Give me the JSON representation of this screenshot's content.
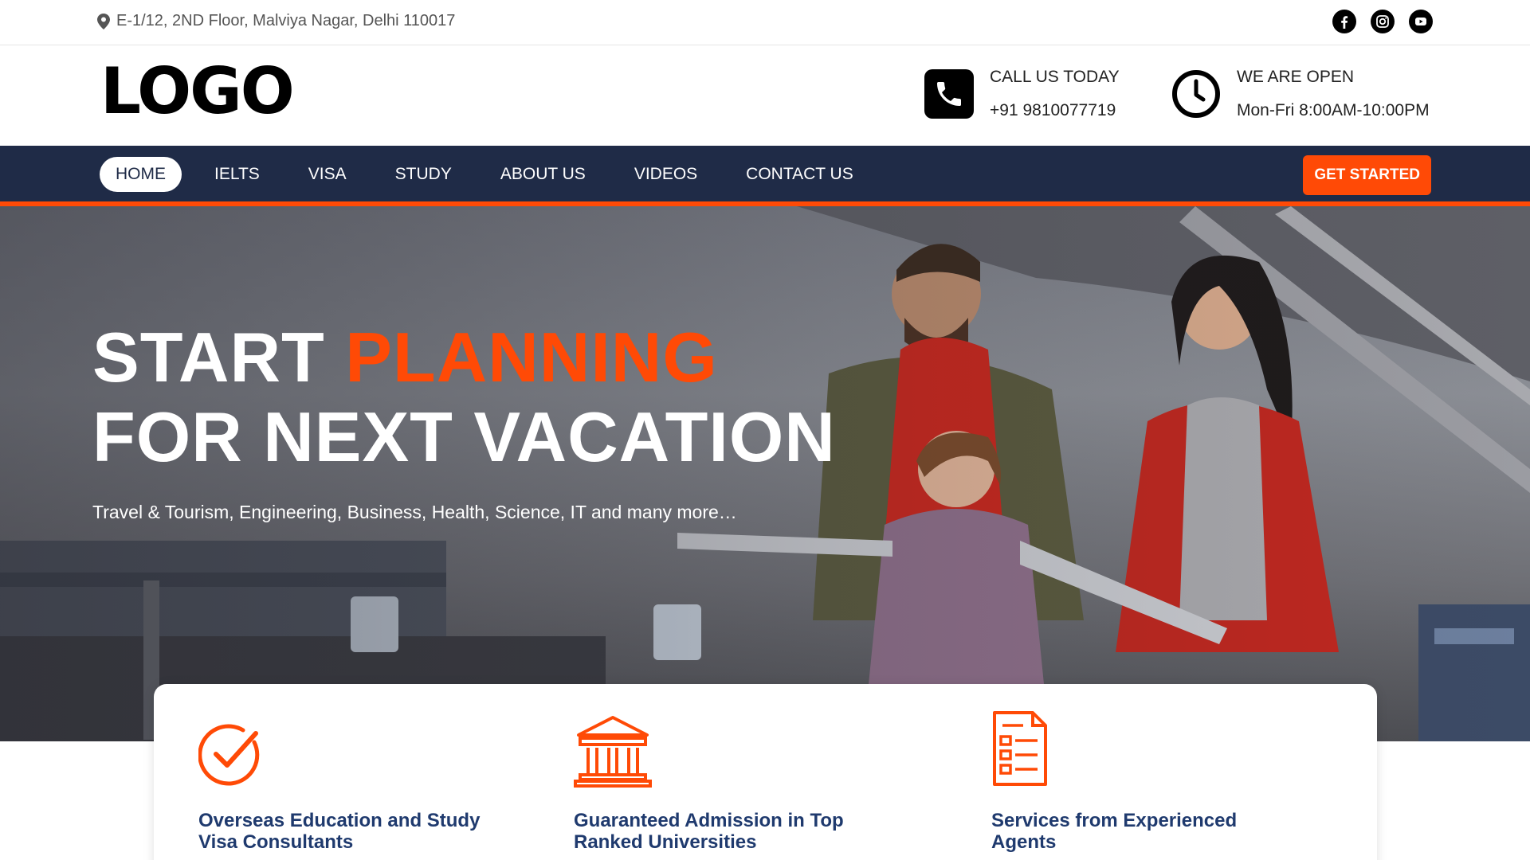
{
  "topbar": {
    "address": "E-1/12, 2ND Floor, Malviya Nagar, Delhi 110017",
    "social": [
      {
        "icon": "facebook-icon"
      },
      {
        "icon": "instagram-icon"
      },
      {
        "icon": "youtube-icon"
      }
    ]
  },
  "header": {
    "logo": "LOGO",
    "call": {
      "label": "CALL US TODAY",
      "value": "+91 9810077719",
      "icon": "phone-icon"
    },
    "open": {
      "label": "WE ARE OPEN",
      "value": "Mon-Fri 8:00AM-10:00PM",
      "icon": "clock-icon"
    }
  },
  "nav": {
    "items": [
      "HOME",
      "IELTS",
      "VISA",
      "STUDY",
      "ABOUT US",
      "VIDEOS",
      "CONTACT US"
    ],
    "active": "HOME",
    "cta": "GET STARTED"
  },
  "hero": {
    "title_part1": "START ",
    "title_accent": "PLANNING",
    "title_line2": "FOR NEXT VACATION",
    "subtitle": "Travel & Tourism, Engineering, Business, Health, Science, IT and many more…"
  },
  "features": [
    {
      "icon": "check-circle-icon",
      "title": "Overseas Education and Study Visa Consultants"
    },
    {
      "icon": "university-icon",
      "title": "Guaranteed Admission in Top Ranked Universities"
    },
    {
      "icon": "document-list-icon",
      "title": "Services from Experienced Agents"
    }
  ],
  "colors": {
    "accent": "#ff4a06",
    "nav_bg": "#1f2b47",
    "feature_title": "#1f3a6e"
  }
}
